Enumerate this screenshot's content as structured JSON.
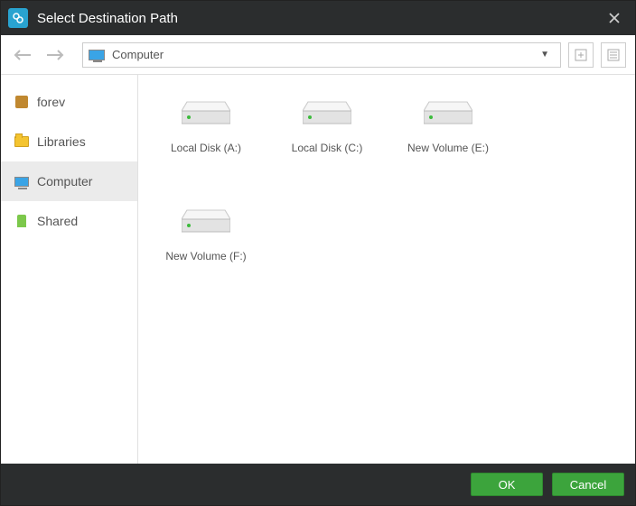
{
  "title": "Select Destination Path",
  "path_label": "Computer",
  "sidebar": {
    "items": [
      {
        "label": "forev"
      },
      {
        "label": "Libraries"
      },
      {
        "label": "Computer"
      },
      {
        "label": "Shared"
      }
    ]
  },
  "drives": [
    {
      "label": "Local Disk (A:)"
    },
    {
      "label": "Local Disk (C:)"
    },
    {
      "label": "New Volume (E:)"
    },
    {
      "label": "New Volume (F:)"
    }
  ],
  "footer": {
    "ok": "OK",
    "cancel": "Cancel"
  }
}
